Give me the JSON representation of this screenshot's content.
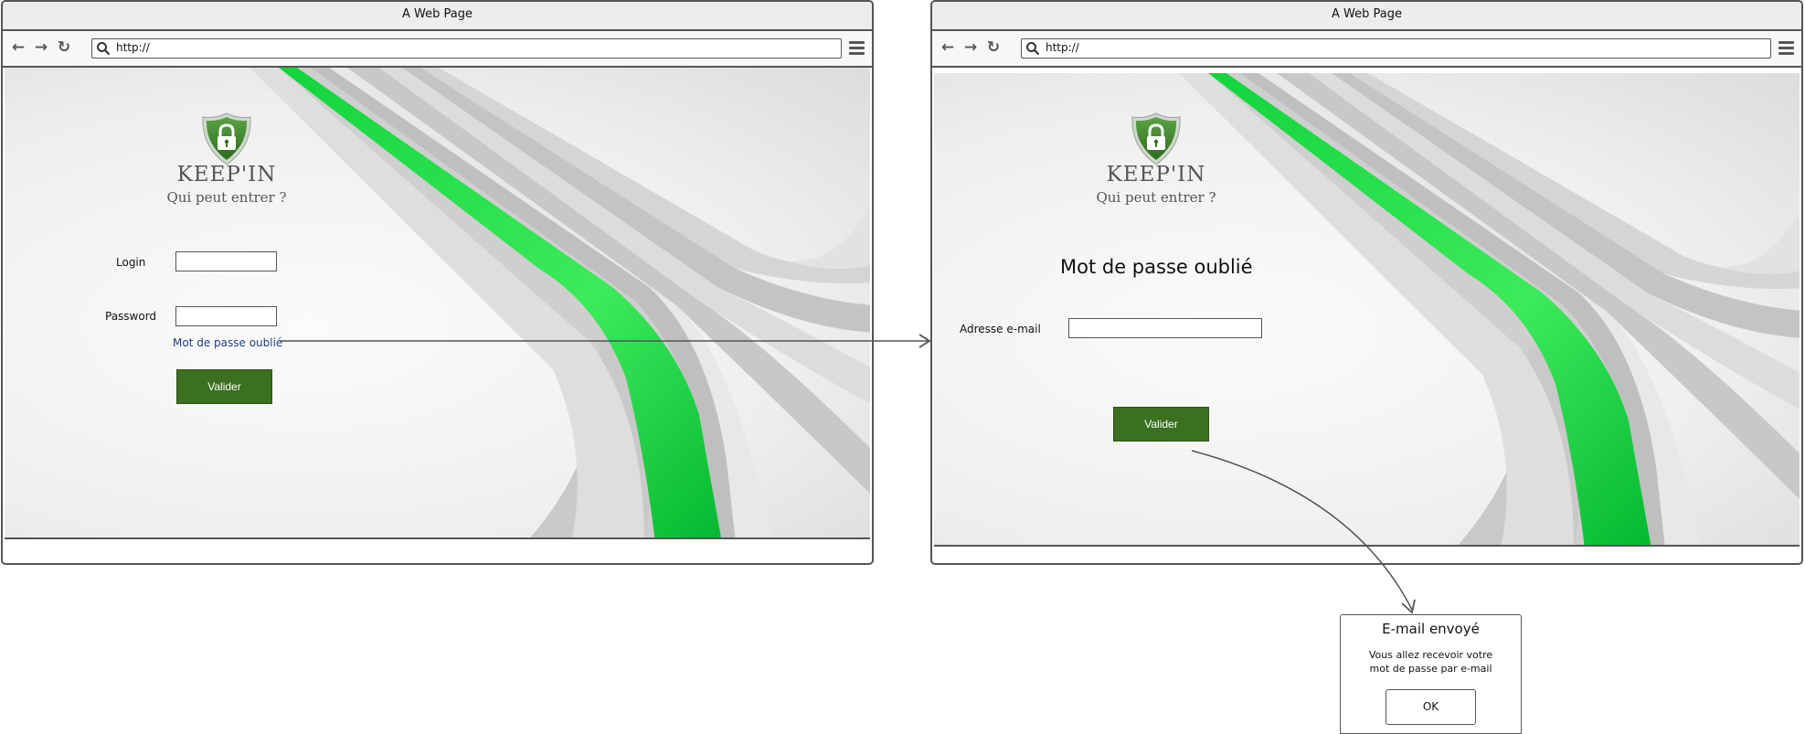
{
  "colors": {
    "accent_green": "#3a7020",
    "stripe_green": "#12c63a",
    "link_blue": "#1e3f88",
    "frame": "#555555"
  },
  "browser_left": {
    "title": "A Web Page",
    "url": "http://",
    "icons": [
      "back-arrow-icon",
      "forward-arrow-icon",
      "reload-icon",
      "search-icon",
      "menu-icon"
    ],
    "brand": "KEEP'IN",
    "tagline": "Qui peut entrer ?",
    "login_label": "Login",
    "password_label": "Password",
    "forgot_link": "Mot de passe oublié",
    "submit_label": "Valider"
  },
  "browser_right": {
    "title": "A Web Page",
    "url": "http://",
    "brand": "KEEP'IN",
    "tagline": "Qui peut entrer ?",
    "heading": "Mot de passe oublié",
    "email_label": "Adresse e-mail",
    "submit_label": "Valider"
  },
  "dialog": {
    "title": "E-mail envoyé",
    "message": "Vous allez recevoir votre mot de passe par e-mail",
    "ok_label": "OK"
  }
}
